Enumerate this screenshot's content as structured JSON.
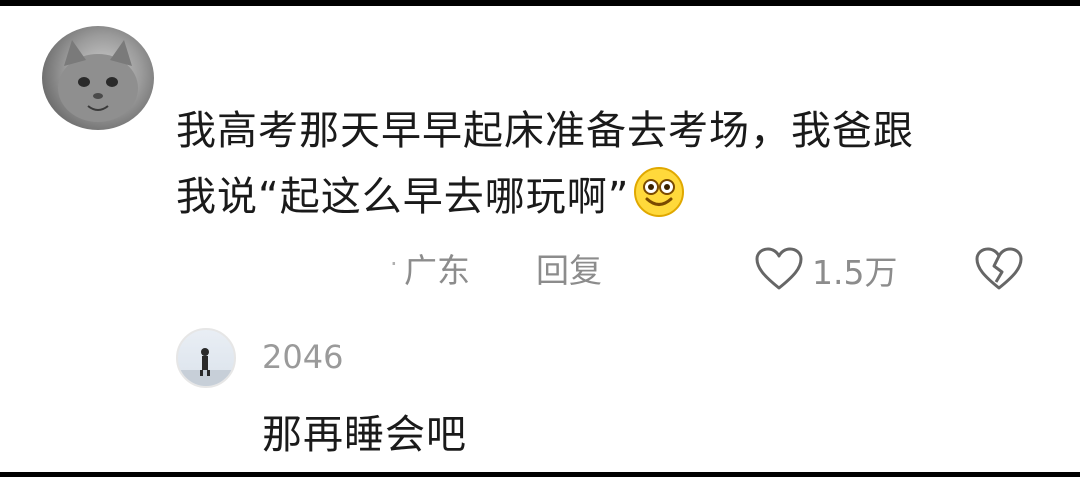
{
  "comment": {
    "text_line1": "我高考那天早早起床准备去考场，我爸跟",
    "text_line2": "我说“起这么早去哪玩啊”",
    "emoji_icon": "smiling-face-icon",
    "location": "广东",
    "reply_label": "回复",
    "like_count": "1.5万",
    "dislike_icon": "broken-heart-icon"
  },
  "reply": {
    "username": "2046",
    "text": "那再睡会吧"
  }
}
